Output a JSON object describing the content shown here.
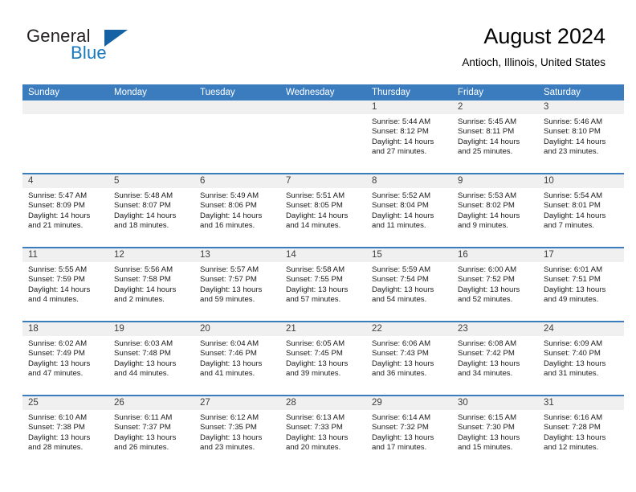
{
  "brand": {
    "name_part1": "General",
    "name_part2": "Blue",
    "logo_icon": "triangle-logo"
  },
  "header": {
    "month_title": "August 2024",
    "location": "Antioch, Illinois, United States"
  },
  "colors": {
    "header_blue": "#3a7cbe",
    "brand_blue": "#1878be",
    "triangle_blue": "#1462a4",
    "day_strip_gray": "#f0f0f0"
  },
  "weekdays": [
    "Sunday",
    "Monday",
    "Tuesday",
    "Wednesday",
    "Thursday",
    "Friday",
    "Saturday"
  ],
  "weeks": [
    [
      {
        "day": "",
        "empty": true
      },
      {
        "day": "",
        "empty": true
      },
      {
        "day": "",
        "empty": true
      },
      {
        "day": "",
        "empty": true
      },
      {
        "day": "1",
        "sunrise": "Sunrise: 5:44 AM",
        "sunset": "Sunset: 8:12 PM",
        "daylight": "Daylight: 14 hours and 27 minutes."
      },
      {
        "day": "2",
        "sunrise": "Sunrise: 5:45 AM",
        "sunset": "Sunset: 8:11 PM",
        "daylight": "Daylight: 14 hours and 25 minutes."
      },
      {
        "day": "3",
        "sunrise": "Sunrise: 5:46 AM",
        "sunset": "Sunset: 8:10 PM",
        "daylight": "Daylight: 14 hours and 23 minutes."
      }
    ],
    [
      {
        "day": "4",
        "sunrise": "Sunrise: 5:47 AM",
        "sunset": "Sunset: 8:09 PM",
        "daylight": "Daylight: 14 hours and 21 minutes."
      },
      {
        "day": "5",
        "sunrise": "Sunrise: 5:48 AM",
        "sunset": "Sunset: 8:07 PM",
        "daylight": "Daylight: 14 hours and 18 minutes."
      },
      {
        "day": "6",
        "sunrise": "Sunrise: 5:49 AM",
        "sunset": "Sunset: 8:06 PM",
        "daylight": "Daylight: 14 hours and 16 minutes."
      },
      {
        "day": "7",
        "sunrise": "Sunrise: 5:51 AM",
        "sunset": "Sunset: 8:05 PM",
        "daylight": "Daylight: 14 hours and 14 minutes."
      },
      {
        "day": "8",
        "sunrise": "Sunrise: 5:52 AM",
        "sunset": "Sunset: 8:04 PM",
        "daylight": "Daylight: 14 hours and 11 minutes."
      },
      {
        "day": "9",
        "sunrise": "Sunrise: 5:53 AM",
        "sunset": "Sunset: 8:02 PM",
        "daylight": "Daylight: 14 hours and 9 minutes."
      },
      {
        "day": "10",
        "sunrise": "Sunrise: 5:54 AM",
        "sunset": "Sunset: 8:01 PM",
        "daylight": "Daylight: 14 hours and 7 minutes."
      }
    ],
    [
      {
        "day": "11",
        "sunrise": "Sunrise: 5:55 AM",
        "sunset": "Sunset: 7:59 PM",
        "daylight": "Daylight: 14 hours and 4 minutes."
      },
      {
        "day": "12",
        "sunrise": "Sunrise: 5:56 AM",
        "sunset": "Sunset: 7:58 PM",
        "daylight": "Daylight: 14 hours and 2 minutes."
      },
      {
        "day": "13",
        "sunrise": "Sunrise: 5:57 AM",
        "sunset": "Sunset: 7:57 PM",
        "daylight": "Daylight: 13 hours and 59 minutes."
      },
      {
        "day": "14",
        "sunrise": "Sunrise: 5:58 AM",
        "sunset": "Sunset: 7:55 PM",
        "daylight": "Daylight: 13 hours and 57 minutes."
      },
      {
        "day": "15",
        "sunrise": "Sunrise: 5:59 AM",
        "sunset": "Sunset: 7:54 PM",
        "daylight": "Daylight: 13 hours and 54 minutes."
      },
      {
        "day": "16",
        "sunrise": "Sunrise: 6:00 AM",
        "sunset": "Sunset: 7:52 PM",
        "daylight": "Daylight: 13 hours and 52 minutes."
      },
      {
        "day": "17",
        "sunrise": "Sunrise: 6:01 AM",
        "sunset": "Sunset: 7:51 PM",
        "daylight": "Daylight: 13 hours and 49 minutes."
      }
    ],
    [
      {
        "day": "18",
        "sunrise": "Sunrise: 6:02 AM",
        "sunset": "Sunset: 7:49 PM",
        "daylight": "Daylight: 13 hours and 47 minutes."
      },
      {
        "day": "19",
        "sunrise": "Sunrise: 6:03 AM",
        "sunset": "Sunset: 7:48 PM",
        "daylight": "Daylight: 13 hours and 44 minutes."
      },
      {
        "day": "20",
        "sunrise": "Sunrise: 6:04 AM",
        "sunset": "Sunset: 7:46 PM",
        "daylight": "Daylight: 13 hours and 41 minutes."
      },
      {
        "day": "21",
        "sunrise": "Sunrise: 6:05 AM",
        "sunset": "Sunset: 7:45 PM",
        "daylight": "Daylight: 13 hours and 39 minutes."
      },
      {
        "day": "22",
        "sunrise": "Sunrise: 6:06 AM",
        "sunset": "Sunset: 7:43 PM",
        "daylight": "Daylight: 13 hours and 36 minutes."
      },
      {
        "day": "23",
        "sunrise": "Sunrise: 6:08 AM",
        "sunset": "Sunset: 7:42 PM",
        "daylight": "Daylight: 13 hours and 34 minutes."
      },
      {
        "day": "24",
        "sunrise": "Sunrise: 6:09 AM",
        "sunset": "Sunset: 7:40 PM",
        "daylight": "Daylight: 13 hours and 31 minutes."
      }
    ],
    [
      {
        "day": "25",
        "sunrise": "Sunrise: 6:10 AM",
        "sunset": "Sunset: 7:38 PM",
        "daylight": "Daylight: 13 hours and 28 minutes."
      },
      {
        "day": "26",
        "sunrise": "Sunrise: 6:11 AM",
        "sunset": "Sunset: 7:37 PM",
        "daylight": "Daylight: 13 hours and 26 minutes."
      },
      {
        "day": "27",
        "sunrise": "Sunrise: 6:12 AM",
        "sunset": "Sunset: 7:35 PM",
        "daylight": "Daylight: 13 hours and 23 minutes."
      },
      {
        "day": "28",
        "sunrise": "Sunrise: 6:13 AM",
        "sunset": "Sunset: 7:33 PM",
        "daylight": "Daylight: 13 hours and 20 minutes."
      },
      {
        "day": "29",
        "sunrise": "Sunrise: 6:14 AM",
        "sunset": "Sunset: 7:32 PM",
        "daylight": "Daylight: 13 hours and 17 minutes."
      },
      {
        "day": "30",
        "sunrise": "Sunrise: 6:15 AM",
        "sunset": "Sunset: 7:30 PM",
        "daylight": "Daylight: 13 hours and 15 minutes."
      },
      {
        "day": "31",
        "sunrise": "Sunrise: 6:16 AM",
        "sunset": "Sunset: 7:28 PM",
        "daylight": "Daylight: 13 hours and 12 minutes."
      }
    ]
  ]
}
